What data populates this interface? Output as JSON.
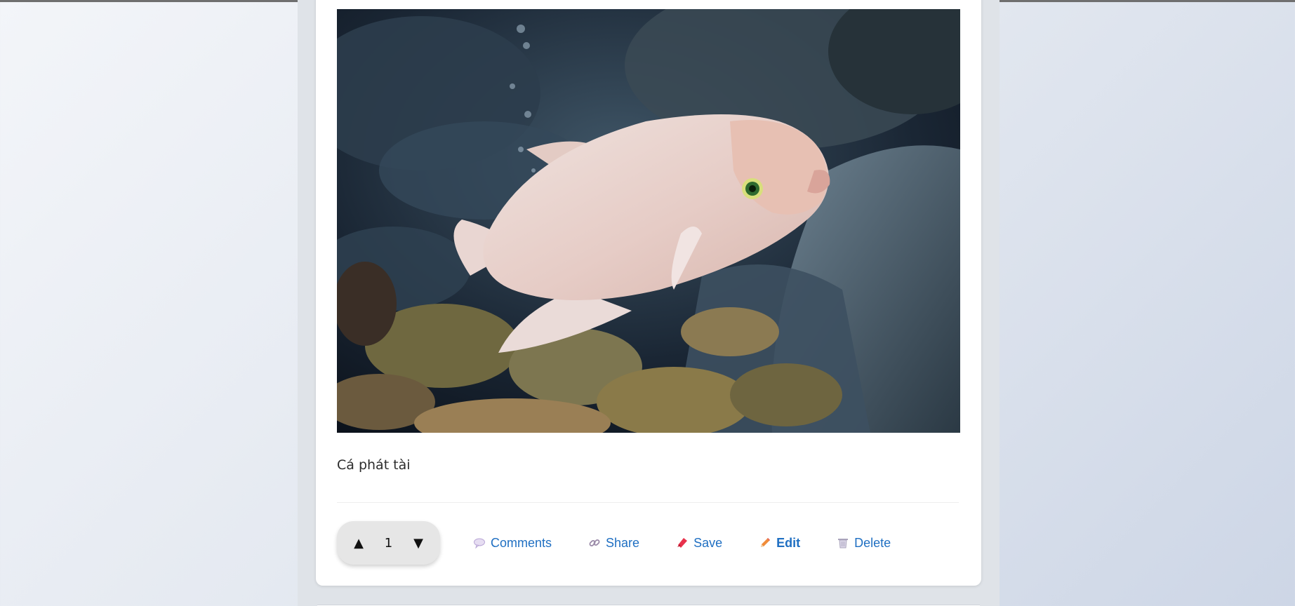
{
  "post": {
    "caption": "Cá phát tài",
    "image_subject": "giant gourami fish in aquarium",
    "vote_count": "1",
    "upvote_symbol": "▲",
    "downvote_symbol": "▼"
  },
  "actions": {
    "comments": {
      "label": "Comments",
      "icon": "speech-bubble-icon"
    },
    "share": {
      "label": "Share",
      "icon": "link-icon"
    },
    "save": {
      "label": "Save",
      "icon": "bookmark-icon"
    },
    "edit": {
      "label": "Edit",
      "icon": "pencil-icon"
    },
    "delete": {
      "label": "Delete",
      "icon": "trash-icon"
    }
  },
  "colors": {
    "link": "#1f6fc2",
    "card": "#ffffff",
    "column": "#dfe3e8",
    "vote_pill": "#e6e6e6"
  }
}
